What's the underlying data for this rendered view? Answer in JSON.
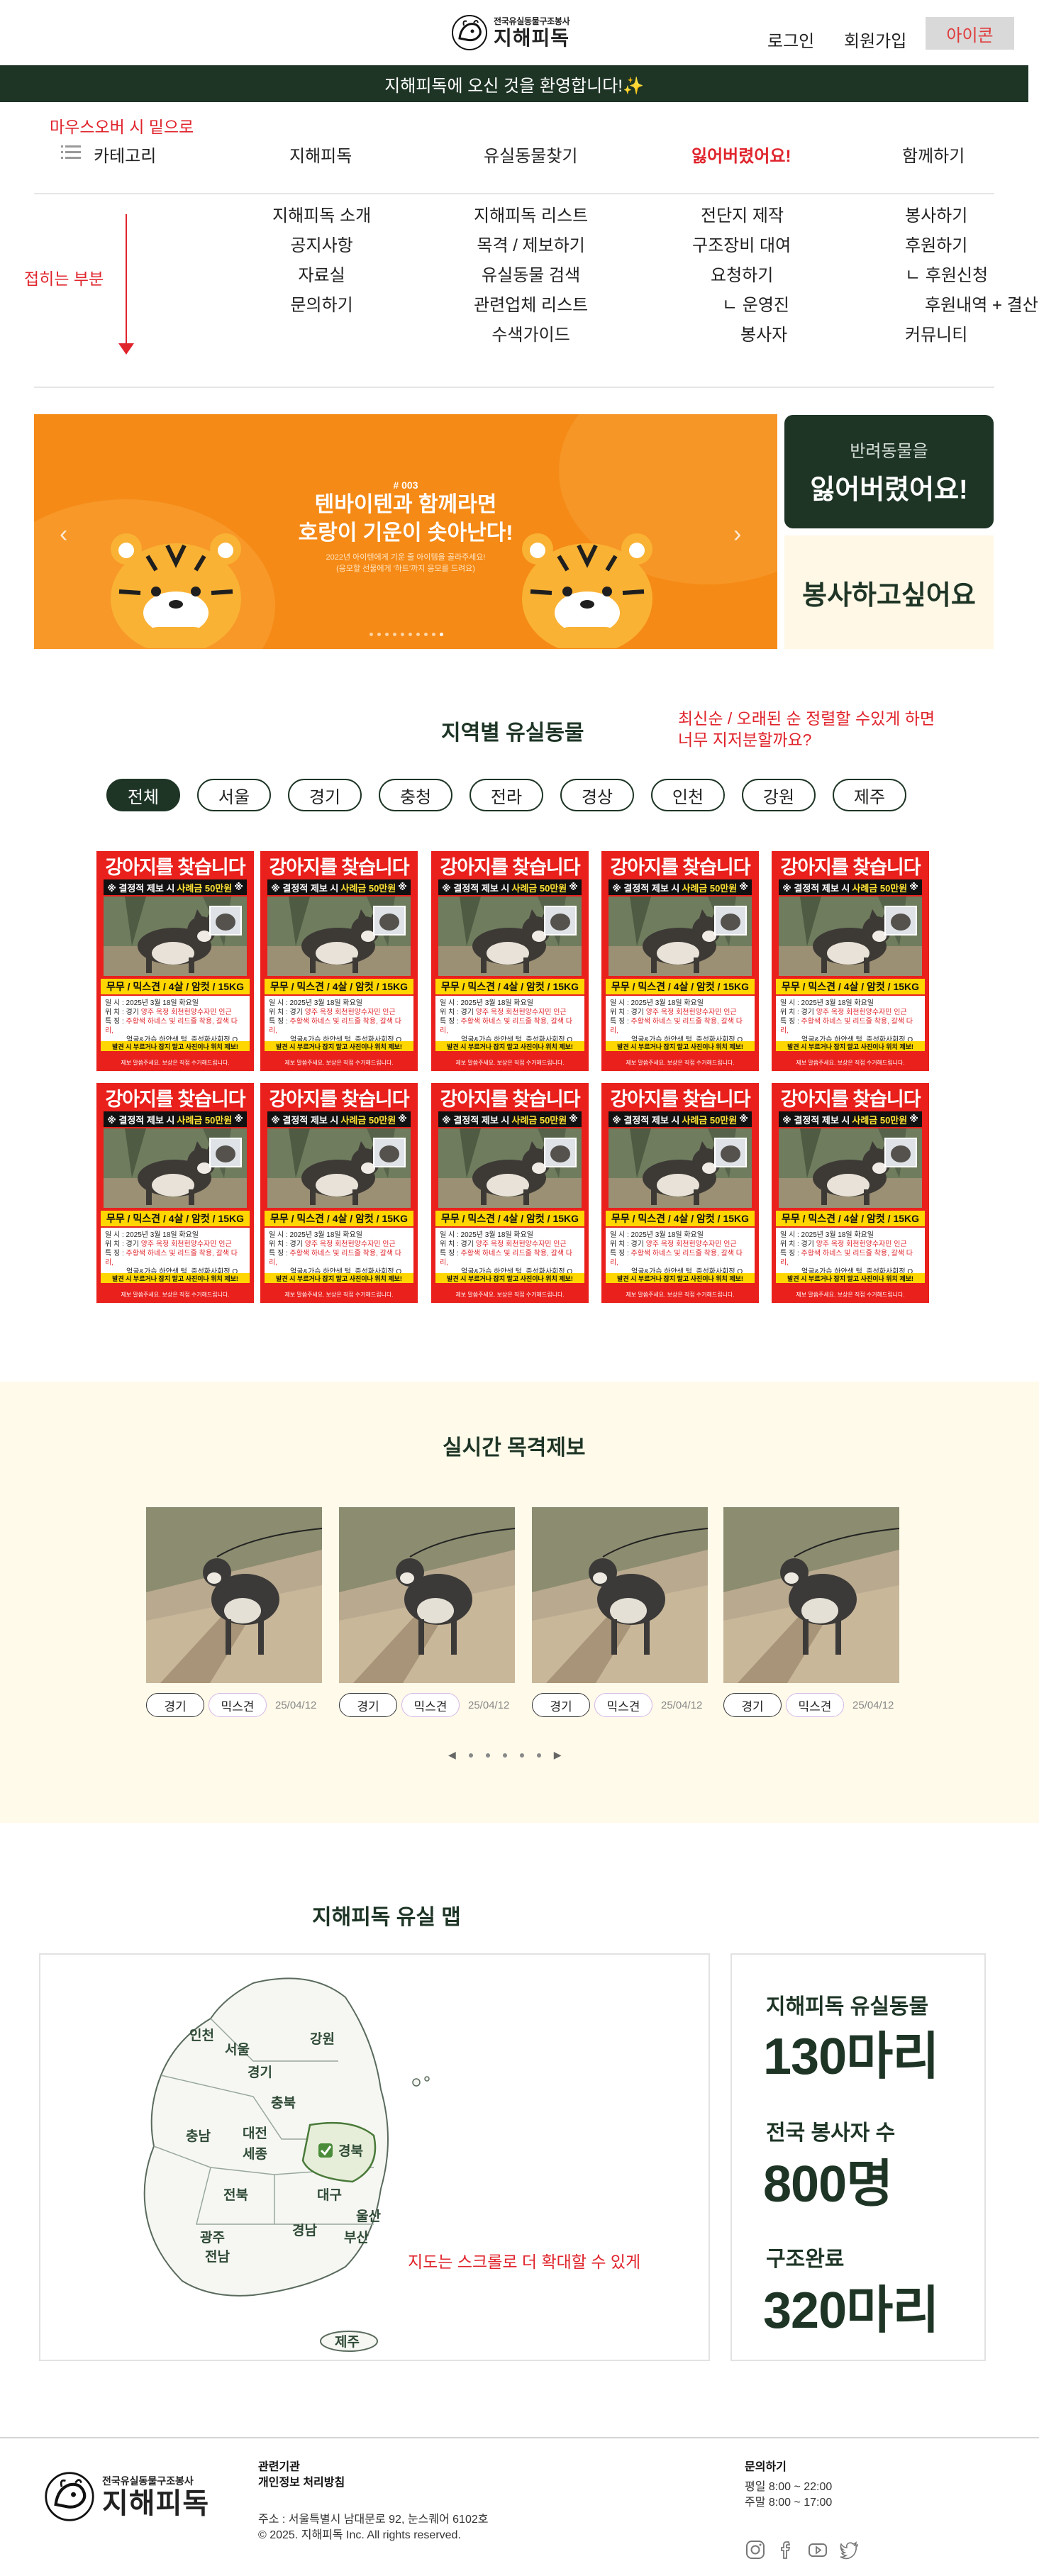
{
  "header": {
    "logo_sub": "전국유실동물구조봉사",
    "logo_main": "지해피독",
    "login": "로그인",
    "signup": "회원가입",
    "icon_button": "아이콘"
  },
  "welcome": "지해피독에 오신 것을 환영합니다!✨",
  "annotations": {
    "hover_note": "마우스오버 시 밑으로",
    "collapse_note": "접히는 부분",
    "sort_note_1": "최신순 / 오래된 순 정렬할 수있게 하면",
    "sort_note_2": "너무 지저분할까요?",
    "map_note": "지도는 스크롤로 더 확대할 수 있게"
  },
  "nav": {
    "category": "카테고리",
    "items": [
      "지해피독",
      "유실동물찾기",
      "잃어버렸어요!",
      "함께하기"
    ]
  },
  "mega_menu": {
    "col1": [
      "지해피독 소개",
      "공지사항",
      "자료실",
      "문의하기"
    ],
    "col2": [
      "지해피독 리스트",
      "목격 / 제보하기",
      "유실동물 검색",
      "관련업체 리스트",
      "수색가이드"
    ],
    "col3": [
      "전단지 제작",
      "구조장비 대여",
      "요청하기",
      "ㄴ 운영진",
      "봉사자"
    ],
    "col4": [
      "봉사하기",
      "후원하기",
      "ㄴ 후원신청",
      "후원내역 + 결산",
      "커뮤니티"
    ]
  },
  "hero": {
    "number": "# 003",
    "headline_1": "텐바이텐과 함께라면",
    "headline_2": "호랑이 기운이 솟아난다!",
    "small_1": "2022년 아이텐에게 기운 줄 아이템을 골라주세요!",
    "small_2": "(응모할 선물에게 '하트'까지 응모를 드려요)",
    "active_slide": 10,
    "total_slides": 10
  },
  "cta": {
    "lost_small": "반려동물을",
    "lost_big": "잃어버렸어요!",
    "volunteer": "봉사하고싶어요"
  },
  "regional": {
    "title": "지역별 유실동물",
    "chips": [
      "전체",
      "서울",
      "경기",
      "충청",
      "전라",
      "경상",
      "인천",
      "강원",
      "제주"
    ],
    "active_chip": "전체"
  },
  "poster": {
    "title": "강아지를 찾습니다",
    "prize_left": "※ 결정적 제보 시",
    "prize_mid": "사례금 50만원",
    "prize_right": "※",
    "breed": "무무 / 믹스견 / 4살 / 암컷 / 15KG",
    "line1_label": "일 시 :",
    "line1": "2025년 3월 18일 화요일",
    "line2_label": "위 치 :",
    "line2_a": "경기",
    "line2_b": "양주 옥정 회천헌양수자민 인근",
    "line3_label": "특 징 :",
    "line3_a": "주황색 하네스 및 리드줄 착용, 갈색 다리,",
    "line3_b": "얼굴&가슴 하얀색 털, 중성화사회정 O",
    "bar": "발견 시 부르거나 잡지 말고 사진이나 위치 제보!",
    "foot": "제보 말씀주세요. 보상은 직접 수거해드립니다."
  },
  "live": {
    "title": "실시간 목격제보",
    "cards": [
      {
        "region": "경기",
        "breed": "믹스견",
        "date": "25/04/12"
      },
      {
        "region": "경기",
        "breed": "믹스견",
        "date": "25/04/12"
      },
      {
        "region": "경기",
        "breed": "믹스견",
        "date": "25/04/12"
      },
      {
        "region": "경기",
        "breed": "믹스견",
        "date": "25/04/12"
      }
    ]
  },
  "map": {
    "title": "지해피독 유실 맵",
    "regions": [
      "인천",
      "서울",
      "경기",
      "강원",
      "충북",
      "충남",
      "대전",
      "세종",
      "경북",
      "전북",
      "대구",
      "울산",
      "경남",
      "부산",
      "광주",
      "전남",
      "제주"
    ],
    "selected_region": "경북"
  },
  "stats": [
    {
      "label": "지해피독 유실동물",
      "value": "130마리"
    },
    {
      "label": "전국 봉사자 수",
      "value": "800명"
    },
    {
      "label": "구조완료",
      "value": "320마리"
    }
  ],
  "footer": {
    "logo_sub": "전국유실동물구조봉사",
    "logo_main": "지해피독",
    "links_1": "관련기관",
    "links_2": "개인정보 처리방침",
    "address": "주소 : 서울특별시 남대문로 92, 눈스퀘어 6102호",
    "copyright": "© 2025. 지해피독 Inc. All rights reserved.",
    "contact_title": "문의하기",
    "weekday": "평일 8:00 ~ 22:00",
    "weekend": "주말 8:00 ~ 17:00",
    "sns_icons": [
      "instagram-icon",
      "facebook-icon",
      "youtube-icon",
      "twitter-icon"
    ]
  },
  "colors": {
    "brand_dark": "#1e3526",
    "accent_red": "#e0242c",
    "hero_orange": "#f58a16",
    "cream": "#fffaea"
  }
}
